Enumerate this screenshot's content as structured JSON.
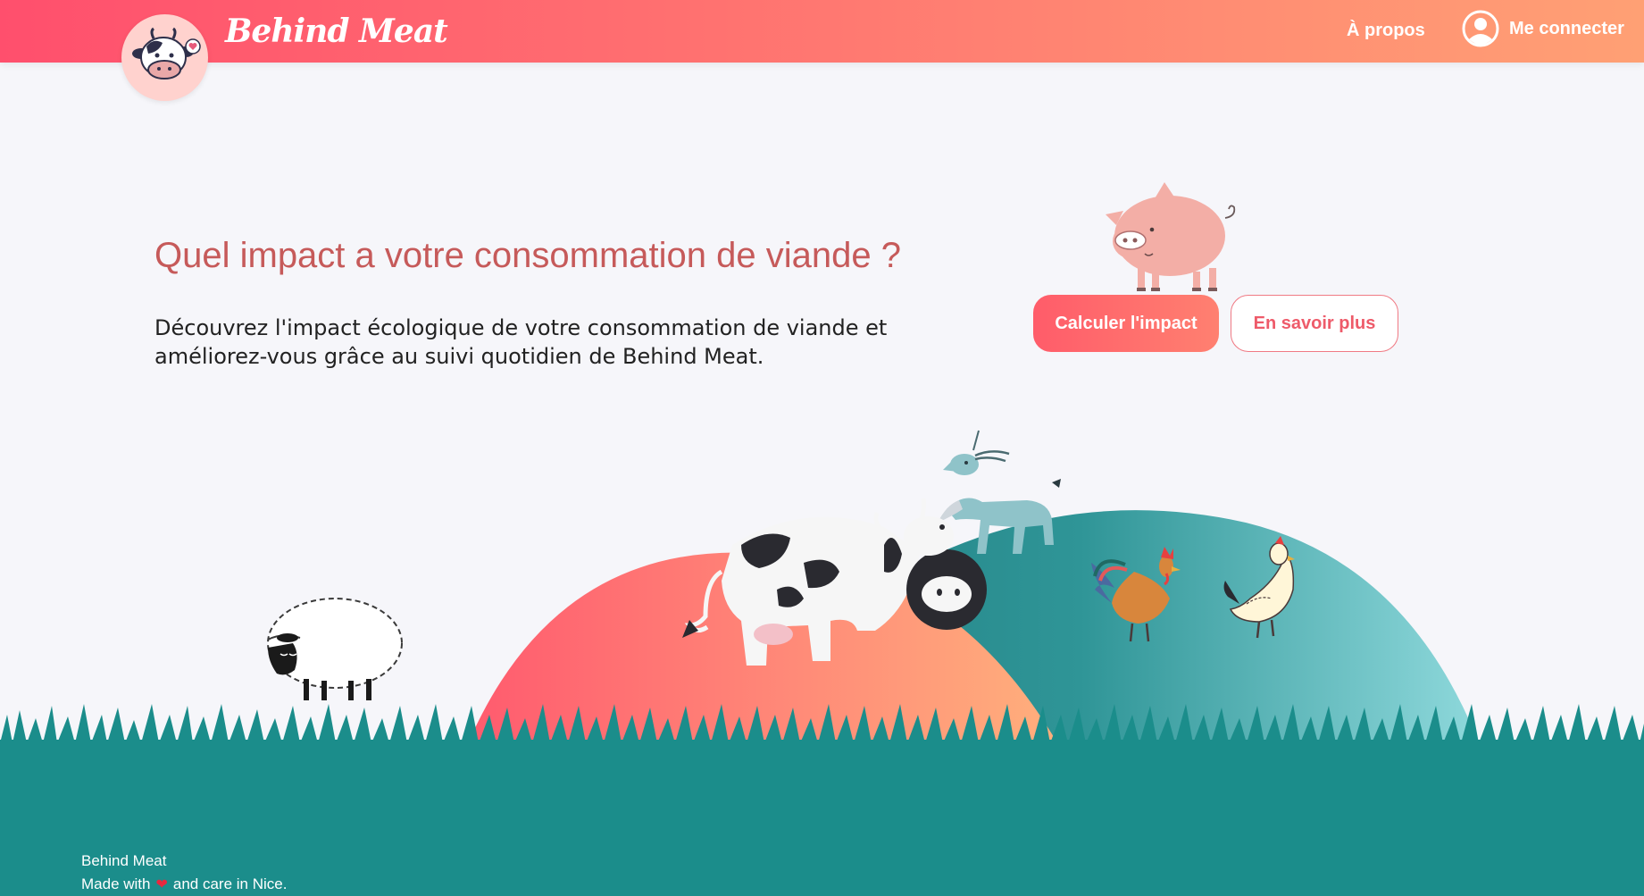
{
  "header": {
    "brand": "Behind Meat",
    "nav": {
      "about_label": "À propos",
      "login_label": "Me connecter"
    },
    "logo_icon": "cow-face-icon",
    "account_icon": "user-circle-icon"
  },
  "hero": {
    "title": "Quel impact a votre consommation de viande ?",
    "description_line1": "Découvrez l'impact écologique de votre consommation de viande et",
    "description_line2": "améliorez-vous grâce au suivi quotidien de Behind Meat.",
    "primary_button": "Calculer l'impact",
    "secondary_button": "En savoir plus"
  },
  "illustration": {
    "animals": [
      "pig-icon",
      "goat-icon",
      "cow-icon",
      "sheep-icon",
      "rooster-icon",
      "hen-icon"
    ]
  },
  "footer": {
    "brand": "Behind Meat",
    "made_prefix": "Made with",
    "made_suffix": "and care in Nice.",
    "heart_icon": "heart-icon"
  },
  "colors": {
    "header_gradient_start": "#ff4f6d",
    "header_gradient_end": "#ffa074",
    "title": "#c65a5a",
    "teal": "#1b8d8b",
    "primary_button": "#ff6a6c"
  }
}
